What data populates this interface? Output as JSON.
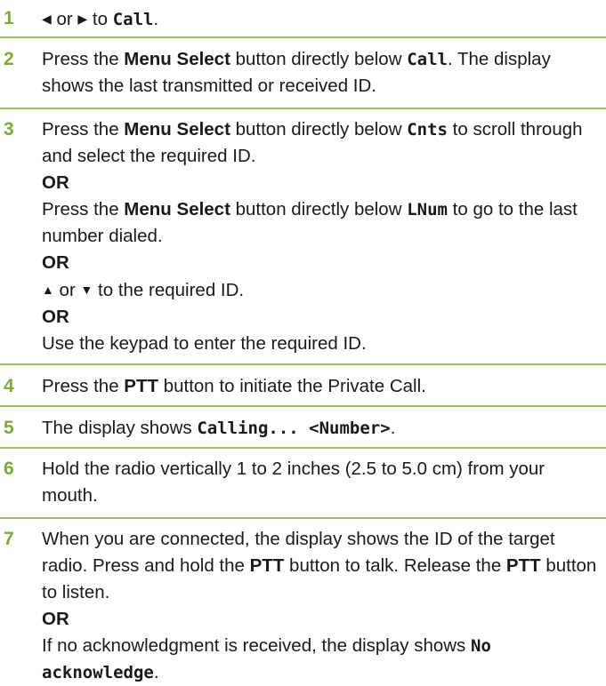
{
  "colors": {
    "accent": "#7daa3c",
    "rule": "#9fbe6a",
    "text": "#1a1a1a"
  },
  "icons": {
    "left": "left-arrow-icon",
    "right": "right-arrow-icon",
    "up": "up-arrow-icon",
    "down": "down-arrow-icon"
  },
  "step1": {
    "num": "1",
    "t1": " or ",
    "t2": " to ",
    "call": "Call",
    "t3": "."
  },
  "step2": {
    "num": "2",
    "t1": "Press the ",
    "menu": "Menu Select",
    "t2": " button directly below ",
    "call": "Call",
    "t3": ". The display shows the last transmitted or received ID."
  },
  "step3": {
    "num": "3",
    "a1": "Press the ",
    "menu": "Menu Select",
    "a2": " button directly below ",
    "cnts": "Cnts",
    "a3": " to scroll through and select the required ID.",
    "or": "OR",
    "b1": "Press the ",
    "b2": " button directly below ",
    "lnum": "LNum",
    "b3": " to go to the last number dialed.",
    "c1": " or ",
    "c2": " to the required ID.",
    "d1": "Use the keypad to enter the required ID."
  },
  "step4": {
    "num": "4",
    "t1": "Press the ",
    "ptt": "PTT",
    "t2": " button to initiate the Private Call."
  },
  "step5": {
    "num": "5",
    "t1": "The display shows ",
    "calling": "Calling... <Number>",
    "t2": "."
  },
  "step6": {
    "num": "6",
    "t1": "Hold the radio vertically 1 to 2 inches (2.5 to 5.0 cm) from your mouth."
  },
  "step7": {
    "num": "7",
    "a1": "When you are connected, the display shows the ID of the target radio. Press and hold the ",
    "ptt": "PTT",
    "a2": " button to talk. Release the ",
    "a3": " button to listen.",
    "or": "OR",
    "b1": "If no acknowledgment is received, the display shows ",
    "noack": "No acknowledge",
    "b2": "."
  }
}
